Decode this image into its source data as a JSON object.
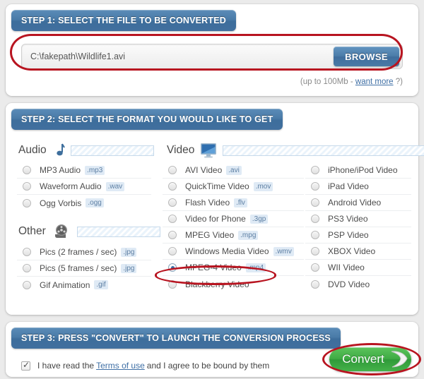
{
  "step1": {
    "header": "STEP 1: SELECT THE FILE TO BE CONVERTED",
    "file_path_value": "C:\\fakepath\\Wildlife1.avi",
    "file_path_placeholder": "",
    "browse_label": "BROWSE",
    "size_hint_prefix": "(up to 100Mb - ",
    "size_hint_link": "want more",
    "size_hint_suffix": " ?)"
  },
  "step2": {
    "header": "STEP 2: SELECT THE FORMAT YOU WOULD LIKE TO GET",
    "categories": {
      "audio": {
        "label": "Audio",
        "icon": "music-note-icon"
      },
      "video": {
        "label": "Video",
        "icon": "monitor-icon"
      },
      "other": {
        "label": "Other",
        "icon": "film-reel-icon"
      }
    },
    "audio_options": [
      {
        "label": "MP3 Audio",
        "ext": ".mp3",
        "selected": false
      },
      {
        "label": "Waveform Audio",
        "ext": ".wav",
        "selected": false
      },
      {
        "label": "Ogg Vorbis",
        "ext": ".ogg",
        "selected": false
      }
    ],
    "other_options": [
      {
        "label": "Pics (2 frames / sec)",
        "ext": ".jpg",
        "selected": false
      },
      {
        "label": "Pics (5 frames / sec)",
        "ext": ".jpg",
        "selected": false
      },
      {
        "label": "Gif Animation",
        "ext": ".gif",
        "selected": false
      }
    ],
    "video_options": [
      {
        "label": "AVI Video",
        "ext": ".avi",
        "selected": false
      },
      {
        "label": "QuickTime Video",
        "ext": ".mov",
        "selected": false
      },
      {
        "label": "Flash Video",
        "ext": ".flv",
        "selected": false
      },
      {
        "label": "Video for Phone",
        "ext": ".3gp",
        "selected": false
      },
      {
        "label": "MPEG Video",
        "ext": ".mpg",
        "selected": false
      },
      {
        "label": "Windows Media Video",
        "ext": ".wmv",
        "selected": false
      },
      {
        "label": "MPEG-4 Video",
        "ext": ".mp4",
        "selected": true
      },
      {
        "label": "Blackberry Video",
        "ext": "",
        "selected": false
      }
    ],
    "device_options": [
      {
        "label": "iPhone/iPod Video",
        "ext": "",
        "selected": false
      },
      {
        "label": "iPad Video",
        "ext": "",
        "selected": false
      },
      {
        "label": "Android Video",
        "ext": "",
        "selected": false
      },
      {
        "label": "PS3 Video",
        "ext": "",
        "selected": false
      },
      {
        "label": "PSP Video",
        "ext": "",
        "selected": false
      },
      {
        "label": "XBOX Video",
        "ext": "",
        "selected": false
      },
      {
        "label": "WII Video",
        "ext": "",
        "selected": false
      },
      {
        "label": "DVD Video",
        "ext": "",
        "selected": false
      }
    ]
  },
  "step3": {
    "header": "STEP 3: PRESS \"CONVERT\" TO LAUNCH THE CONVERSION PROCESS",
    "terms_prefix": "I have read the",
    "terms_link": "Terms of use",
    "terms_suffix": "and I agree to be bound by them",
    "terms_checked": true,
    "convert_label": "Convert"
  },
  "colors": {
    "header_blue": "#4a7ba8",
    "highlight_red": "#b81420",
    "convert_green": "#3fab44",
    "ext_badge_blue": "#dfeaf5",
    "page_background": "#ebebeb"
  }
}
